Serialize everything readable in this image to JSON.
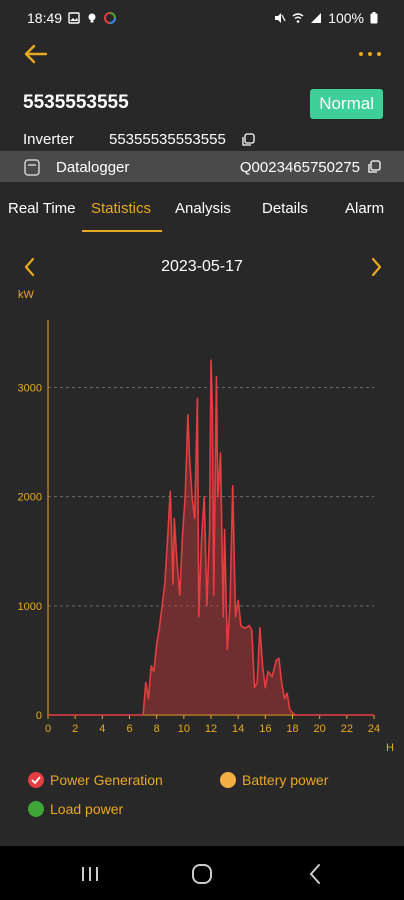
{
  "status": {
    "time": "18:49",
    "battery": "100%"
  },
  "device": {
    "id": "5535553555",
    "status": "Normal"
  },
  "inverter": {
    "label": "Inverter",
    "value": "55355535553555"
  },
  "datalogger": {
    "label": "Datalogger",
    "value": "Q0023465750275"
  },
  "tabs": [
    "Real Time",
    "Statistics",
    "Analysis",
    "Details",
    "Alarm"
  ],
  "active_tab": "Statistics",
  "date": "2023-05-17",
  "colors": {
    "accent": "#e9a921",
    "badge": "#3fcf99",
    "power_generation": "#e53d42",
    "battery": "#f5ae43",
    "load": "#3fa535"
  },
  "legend": {
    "power_generation": "Power Generation",
    "battery_power": "Battery power",
    "load_power": "Load power"
  },
  "chart_data": {
    "type": "area",
    "ylabel": "kW",
    "xlabel": "H",
    "x_ticks": [
      0,
      2,
      4,
      6,
      8,
      10,
      12,
      14,
      16,
      18,
      20,
      22,
      24
    ],
    "y_ticks": [
      0,
      1000,
      2000,
      3000
    ],
    "ylim": [
      0,
      3600
    ],
    "xlim": [
      0,
      24
    ],
    "grid": "dashed horizontal",
    "series": [
      {
        "name": "Power Generation",
        "x": [
          0,
          7.0,
          7.2,
          7.4,
          7.6,
          7.8,
          8.0,
          8.2,
          8.4,
          8.6,
          8.8,
          9.0,
          9.2,
          9.3,
          9.5,
          9.7,
          9.9,
          10.1,
          10.3,
          10.4,
          10.6,
          10.8,
          11.0,
          11.1,
          11.3,
          11.5,
          11.7,
          11.9,
          12.0,
          12.1,
          12.2,
          12.4,
          12.5,
          12.7,
          12.9,
          13.0,
          13.2,
          13.4,
          13.6,
          13.8,
          14.0,
          14.2,
          14.4,
          14.6,
          14.8,
          15.0,
          15.2,
          15.4,
          15.6,
          15.8,
          16.0,
          16.2,
          16.5,
          16.8,
          17.0,
          17.2,
          17.4,
          17.6,
          17.8,
          18.0,
          18.2,
          24
        ],
        "y": [
          0,
          0,
          300,
          150,
          450,
          400,
          650,
          800,
          1000,
          1200,
          1600,
          2050,
          1200,
          1800,
          1400,
          1100,
          1650,
          2000,
          2750,
          2400,
          2000,
          1800,
          2900,
          900,
          1600,
          2000,
          1000,
          1700,
          3250,
          2800,
          1100,
          3100,
          2000,
          2400,
          900,
          1700,
          600,
          1000,
          2100,
          900,
          1050,
          820,
          800,
          800,
          820,
          780,
          250,
          300,
          800,
          450,
          250,
          400,
          350,
          500,
          520,
          300,
          150,
          200,
          50,
          20,
          0,
          0
        ]
      },
      {
        "name": "Battery power",
        "x": [
          0,
          24
        ],
        "y": [
          0,
          0
        ]
      },
      {
        "name": "Load power",
        "x": [
          0,
          24
        ],
        "y": [
          0,
          0
        ]
      }
    ]
  }
}
